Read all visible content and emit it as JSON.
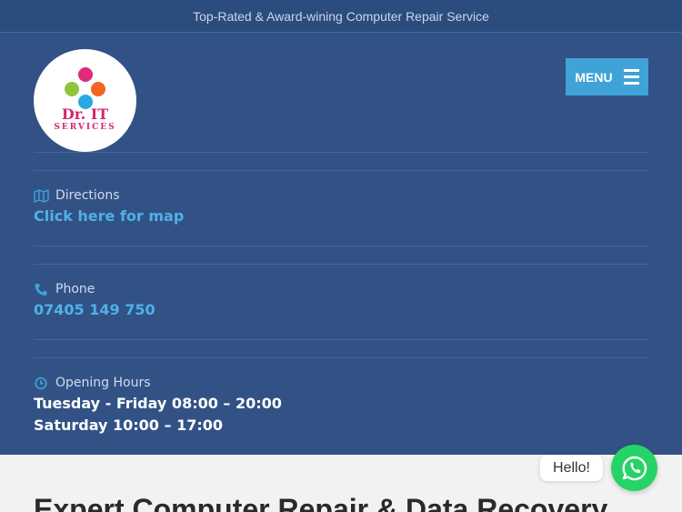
{
  "topbar": {
    "tagline": "Top-Rated & Award-wining Computer Repair Service"
  },
  "logo": {
    "line1": "Dr. IT",
    "line2": "SERVICES"
  },
  "menu": {
    "label": "MENU"
  },
  "directions": {
    "label": "Directions",
    "link": "Click here for map",
    "icon": "map-icon"
  },
  "phone": {
    "label": "Phone",
    "number": "07405 149 750",
    "icon": "phone-icon"
  },
  "hours": {
    "label": "Opening Hours",
    "icon": "clock-icon",
    "lines": [
      "Tuesday - Friday 08:00 – 20:00",
      "Saturday 10:00 – 17:00"
    ]
  },
  "main": {
    "heading": "Expert Computer Repair & Data Recovery"
  },
  "chat": {
    "bubble": "Hello!",
    "icon": "whatsapp-icon"
  },
  "colors": {
    "topbar_bg": "#2b4d7d",
    "header_bg": "#325286",
    "accent": "#3fa3d8",
    "link": "#4fb1e6",
    "whatsapp": "#25d366"
  }
}
